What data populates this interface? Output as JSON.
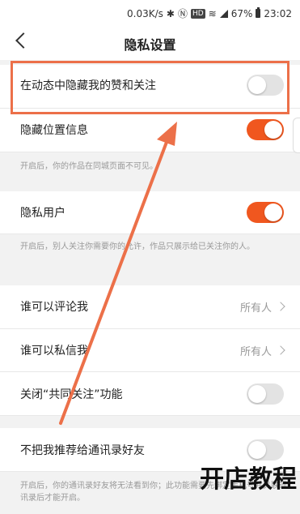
{
  "status_bar": {
    "speed": "0.03K/s",
    "hd": "HD",
    "battery": "67%",
    "time": "23:02"
  },
  "nav": {
    "title": "隐私设置"
  },
  "settings": {
    "hide_likes": {
      "label": "在动态中隐藏我的赞和关注",
      "state": "off"
    },
    "hide_location": {
      "label": "隐藏位置信息",
      "state": "on",
      "note": "开启后，你的作品在同城页面不可见。"
    },
    "private_user": {
      "label": "隐私用户",
      "state": "on",
      "note": "开启后，别人关注你需要你的允许，作品只展示给已关注你的人。"
    },
    "who_can_comment": {
      "label": "谁可以评论我",
      "value": "所有人"
    },
    "who_can_message": {
      "label": "谁可以私信我",
      "value": "所有人"
    },
    "mutual_follow": {
      "label": "关闭“共同关注”功能",
      "state": "off"
    },
    "no_recommend_contacts": {
      "label": "不把我推荐给通讯录好友",
      "state": "off",
      "note": "开启后，你的通讯录好友将无法看到你；此功能需要先绑定手机号并关联通讯录后才能开启。"
    }
  },
  "watermark": "开店教程",
  "colors": {
    "accent": "#f0571f",
    "annotation": "#ec7049"
  }
}
